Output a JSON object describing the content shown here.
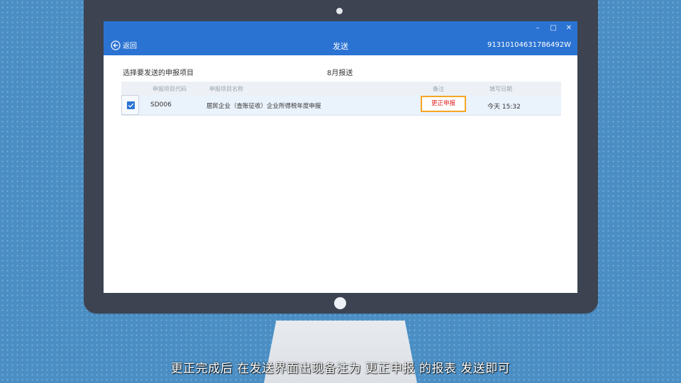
{
  "window": {
    "title": "发送",
    "back_label": "返回",
    "tax_id": "91310104631786492W",
    "controls": [
      "–",
      "□",
      "✕"
    ]
  },
  "content": {
    "instruction": "选择要发送的申报项目",
    "period": "8月报送"
  },
  "table": {
    "headers": {
      "code": "申报项目代码",
      "name": "申报项目名称",
      "remark": "备注",
      "date": "填写日期"
    },
    "rows": [
      {
        "checked": true,
        "code": "SD006",
        "name": "居民企业（查账征收）企业所得税年度申报",
        "remark": "更正申报",
        "date": "今天 15:32"
      }
    ]
  },
  "subtitle": "更正完成后 在发送界面出现备注为 更正申报 的报表 发送即可",
  "colors": {
    "titlebar": "#2b73d2",
    "highlight_border": "#f5a623",
    "remark_text": "#e02020",
    "background": "#4a8ec4"
  },
  "icons": {
    "back": "back-arrow-circle-icon",
    "checkbox": "checkmark-icon"
  }
}
